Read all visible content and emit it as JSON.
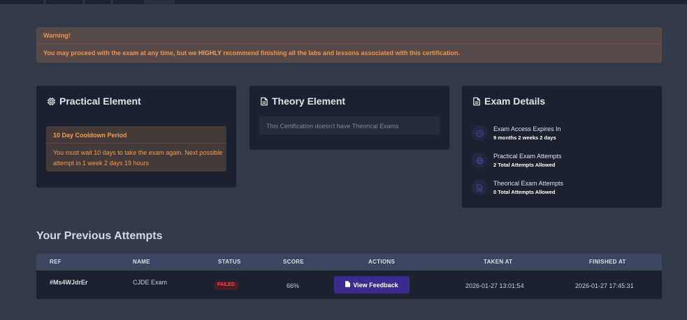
{
  "warning": {
    "title": "Warning!",
    "text_before": "You may proceed with the exam at any time, but we ",
    "text_emphasis": "HIGHLY",
    "text_after": " recommend finishing all the labs and lessons associated with this certification."
  },
  "practical": {
    "title": "Practical Element",
    "icon": "chip-icon",
    "cooldown_title": "10 Day Cooldown Period",
    "cooldown_text": "You must wait 10 days to take the exam again. Next possible attempt in 1 week 2 days 19 hours"
  },
  "theory": {
    "title": "Theory Element",
    "icon": "document-icon",
    "message": "This Certification doesn't have Theorical Exams"
  },
  "exam_details": {
    "title": "Exam Details",
    "icon": "document-icon",
    "items": [
      {
        "label": "Exam Access Expires In",
        "value": "9 months 2 weeks 2 days",
        "icon": "clock-icon"
      },
      {
        "label": "Practical Exam Attempts",
        "value": "2 Total Attempts Allowed",
        "icon": "globe-icon"
      },
      {
        "label": "Theorical Exam Attempts",
        "value": "0 Total Attempts Allowed",
        "icon": "file-icon"
      }
    ]
  },
  "attempts": {
    "title": "Your Previous Attempts",
    "columns": [
      "REF",
      "NAME",
      "STATUS",
      "SCORE",
      "ACTIONS",
      "TAKEN AT",
      "FINISHED AT"
    ],
    "rows": [
      {
        "ref": "#Ms4WJdrEr",
        "name": "CJDE Exam",
        "status": "FAILED",
        "score": "66%",
        "action": "View Feedback",
        "taken_at": "2026-01-27 13:01:54",
        "finished_at": "2026-01-27 17:45:31"
      }
    ]
  },
  "colors": {
    "background": "#333a4a",
    "card": "#1c2130",
    "warning_text": "#f0924b",
    "failed": "#f04b58",
    "button": "#3b2b8f"
  }
}
